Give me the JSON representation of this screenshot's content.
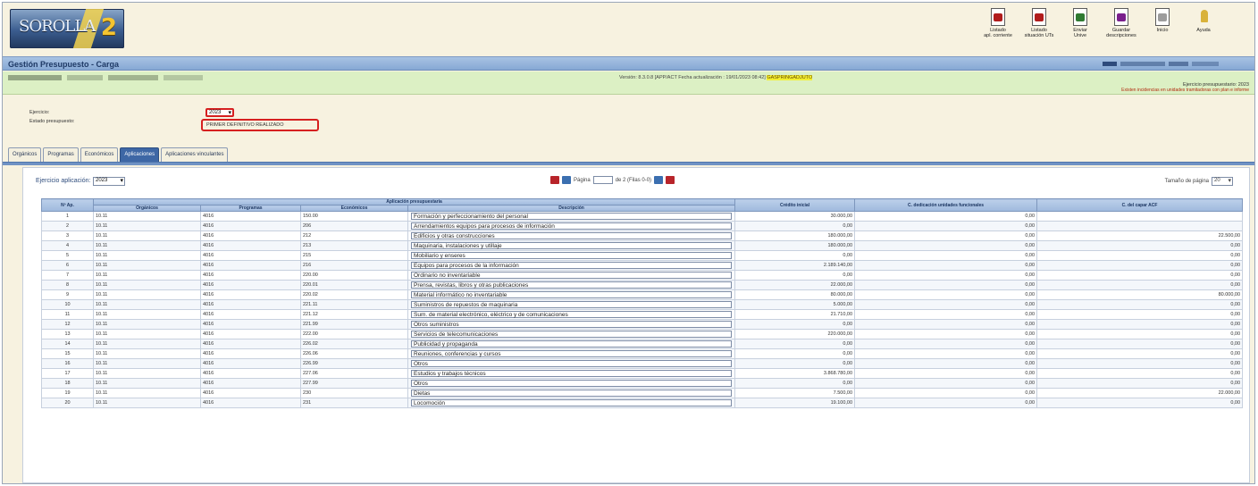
{
  "header": {
    "logo_text": "SOROLLA",
    "logo_num": "2",
    "toolbar": [
      {
        "label": "Listado\napl. corriente",
        "icon": "pdf-icon"
      },
      {
        "label": "Listado\nsituación UTs",
        "icon": "pdf-icon"
      },
      {
        "label": "Enviar\nUnive",
        "icon": "excel-icon"
      },
      {
        "label": "Guardar\ndescripciones",
        "icon": "document-icon"
      },
      {
        "label": "Inicio",
        "icon": "home-icon"
      },
      {
        "label": "Ayuda",
        "icon": "help-icon"
      }
    ]
  },
  "title": "Gestión Presupuesto - Carga",
  "infobar": {
    "version_text": "Versión: 8.3.0.8 [APP/ACT Fecha actualización : 19/01/2023 08:42] ",
    "version_highlight": "GASPRINGADJUTO",
    "ejercicio_text": "Ejercicio presupuestario: 2023",
    "warning_text": "Existen incidencias en unidades tramitadoras con plan e informe"
  },
  "form": {
    "ejercicio_label": "Ejercicio:",
    "ejercicio_value": "2023",
    "estado_label": "Estado presupuesto:",
    "estado_value": "PRIMER DEFINITIVO REALIZADO"
  },
  "tabs": [
    {
      "label": "Orgánicos",
      "active": false
    },
    {
      "label": "Programas",
      "active": false
    },
    {
      "label": "Económicos",
      "active": false
    },
    {
      "label": "Aplicaciones",
      "active": true
    },
    {
      "label": "Aplicaciones vinculantes",
      "active": false
    }
  ],
  "panel": {
    "ejercicio_app_label": "Ejercicio aplicación:",
    "ejercicio_app_value": "2023",
    "pager_label": "Página",
    "pager_of": "de 2 (Filas 0-0)",
    "pagesize_label": "Tamaño de página",
    "pagesize_value": "20"
  },
  "table": {
    "group_header": "Aplicación presupuestaria",
    "headers": [
      "Nº Ap.",
      "Orgánicos",
      "Programas",
      "Económicos",
      "Descripción",
      "Crédito inicial",
      "C. dedicación unidades funcionales",
      "C. del capar ACF"
    ],
    "rows": [
      [
        "1",
        "10.11",
        "4016",
        "150.00",
        "Formación y perfeccionamiento del personal",
        "30.000,00",
        "0,00",
        ""
      ],
      [
        "2",
        "10.11",
        "4016",
        "206",
        "Arrendamientos equipos para procesos de información",
        "0,00",
        "0,00",
        ""
      ],
      [
        "3",
        "10.11",
        "4016",
        "212",
        "Edificios y otras construcciones",
        "180.000,00",
        "0,00",
        "22.500,00"
      ],
      [
        "4",
        "10.11",
        "4016",
        "213",
        "Maquinaria, instalaciones y utillaje",
        "180.000,00",
        "0,00",
        "0,00"
      ],
      [
        "5",
        "10.11",
        "4016",
        "215",
        "Mobiliario y enseres",
        "0,00",
        "0,00",
        "0,00"
      ],
      [
        "6",
        "10.11",
        "4016",
        "216",
        "Equipos para procesos de la información",
        "2.189.140,00",
        "0,00",
        "0,00"
      ],
      [
        "7",
        "10.11",
        "4016",
        "220.00",
        "Ordinario no inventariable",
        "0,00",
        "0,00",
        "0,00"
      ],
      [
        "8",
        "10.11",
        "4016",
        "220.01",
        "Prensa, revistas, libros y otras publicaciones",
        "22.000,00",
        "0,00",
        "0,00"
      ],
      [
        "9",
        "10.11",
        "4016",
        "220.02",
        "Material informático no inventariable",
        "80.000,00",
        "0,00",
        "80.000,00"
      ],
      [
        "10",
        "10.11",
        "4016",
        "221.11",
        "Suministros de repuestos de maquinaria",
        "5.000,00",
        "0,00",
        "0,00"
      ],
      [
        "11",
        "10.11",
        "4016",
        "221.12",
        "Sum. de material electrónico, eléctrico y de comunicaciones",
        "21.710,00",
        "0,00",
        "0,00"
      ],
      [
        "12",
        "10.11",
        "4016",
        "221.99",
        "Otros suministros",
        "0,00",
        "0,00",
        "0,00"
      ],
      [
        "13",
        "10.11",
        "4016",
        "222.00",
        "Servicios de telecomunicaciones",
        "220.000,00",
        "0,00",
        "0,00"
      ],
      [
        "14",
        "10.11",
        "4016",
        "226.02",
        "Publicidad y propaganda",
        "0,00",
        "0,00",
        "0,00"
      ],
      [
        "15",
        "10.11",
        "4016",
        "226.06",
        "Reuniones, conferencias y cursos",
        "0,00",
        "0,00",
        "0,00"
      ],
      [
        "16",
        "10.11",
        "4016",
        "226.99",
        "Otros",
        "0,00",
        "0,00",
        "0,00"
      ],
      [
        "17",
        "10.11",
        "4016",
        "227.06",
        "Estudios y trabajos técnicos",
        "3.868.780,00",
        "0,00",
        "0,00"
      ],
      [
        "18",
        "10.11",
        "4016",
        "227.99",
        "Otros",
        "0,00",
        "0,00",
        "0,00"
      ],
      [
        "19",
        "10.11",
        "4016",
        "230",
        "Dietas",
        "7.500,00",
        "0,00",
        "22.000,00"
      ],
      [
        "20",
        "10.11",
        "4016",
        "231",
        "Locomoción",
        "19.100,00",
        "0,00",
        "0,00"
      ]
    ]
  }
}
